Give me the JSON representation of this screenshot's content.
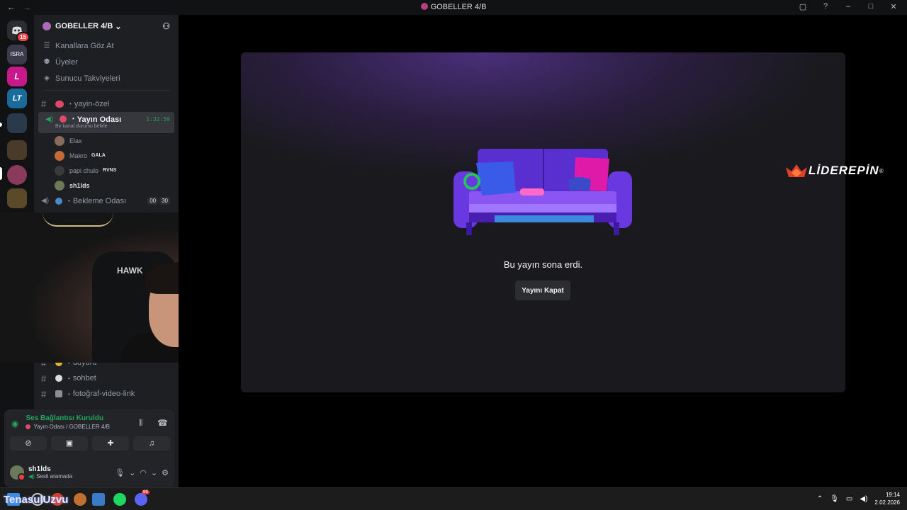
{
  "window": {
    "title": "GOBELLER 4/B",
    "nav_back": "←",
    "nav_forward": "→"
  },
  "guilds": {
    "home_badge": "15",
    "items": [
      "IS RA",
      "L",
      "LT",
      "group",
      "group2",
      "avatar",
      "gold"
    ]
  },
  "server": {
    "name": "GOBELLER 4/B",
    "chevron": "⌄",
    "nav": [
      {
        "label": "Kanallara Göz At",
        "icon": "channels-icon"
      },
      {
        "label": "Üyeler",
        "icon": "members-icon"
      },
      {
        "label": "Sunucu Takviyeleri",
        "icon": "boost-icon"
      }
    ]
  },
  "channels": {
    "yayin_ozel": "yayin-özel",
    "active": {
      "name": "Yayın Odası",
      "timer": "1:32:59",
      "status": "Bir kanal durumu belirle"
    },
    "voice_users": [
      {
        "name": "Elax",
        "tag": ""
      },
      {
        "name": "Makro",
        "tag": "GALA"
      },
      {
        "name": "papi chulo",
        "tag": "RVNS"
      },
      {
        "name": "sh1lds",
        "tag": ""
      }
    ],
    "bekleme": {
      "name": "Bekleme Odası",
      "count_a": "00",
      "count_b": "30"
    },
    "duyuru": "duyuru",
    "sohbet": "sohbet",
    "fotograf": "fotoğraf-video-link"
  },
  "webcam": {
    "chair_brand": "HAWK"
  },
  "voice_panel": {
    "status": "Ses Bağlantısı Kuruldu",
    "location": "Yayın Odası / GOBELLER 4/B"
  },
  "user": {
    "name": "sh1lds",
    "sub": "Sesli aramada"
  },
  "stage": {
    "message": "Bu yayın sona erdi.",
    "close_button": "Yayını Kapat"
  },
  "sponsor": {
    "text": "LİDEREPİN",
    "reg": "®"
  },
  "taskbar": {
    "label": "TenasulUzvu",
    "discord_badge": "99",
    "time": "19:14",
    "date": "2.02.2026"
  },
  "colors": {
    "green": "#23a55a",
    "accent_red": "#f23f43",
    "bg_sidebar": "#1e1f22"
  }
}
